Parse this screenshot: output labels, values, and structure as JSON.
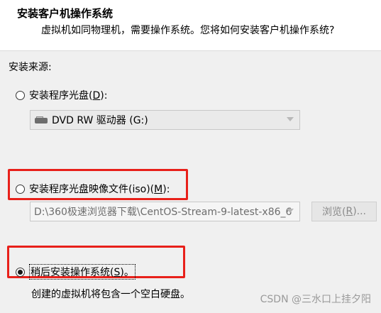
{
  "header": {
    "title": "安装客户机操作系统",
    "subtitle": "虚拟机如同物理机，需要操作系统。您将如何安装客户机操作系统?"
  },
  "install_source": {
    "label": "安装来源:",
    "disc_option": {
      "label": "安装程序光盘(",
      "accel": "D",
      "suffix": "):",
      "selected": false
    },
    "disc_combo": {
      "value": "DVD RW 驱动器 (G:)",
      "icon": "dvd-drive-icon"
    },
    "iso_option": {
      "label": "安装程序光盘映像文件(iso)(",
      "accel": "M",
      "suffix": "):",
      "selected": false
    },
    "iso_path": {
      "value": "D:\\360极速浏览器下载\\CentOS-Stream-9-latest-x86_6"
    },
    "browse_button": {
      "label": "浏览(",
      "accel": "R",
      "suffix": ")..."
    },
    "later_option": {
      "label": "稍后安装操作系统(",
      "accel": "S",
      "suffix": ")。",
      "selected": true
    },
    "later_info": "创建的虚拟机将包含一个空白硬盘。"
  },
  "watermark": "CSDN @三水口上挂夕阳",
  "colors": {
    "highlight_box": "#e8201a",
    "header_bg": "#ffffff",
    "dialog_bg": "#f0f0f0"
  }
}
